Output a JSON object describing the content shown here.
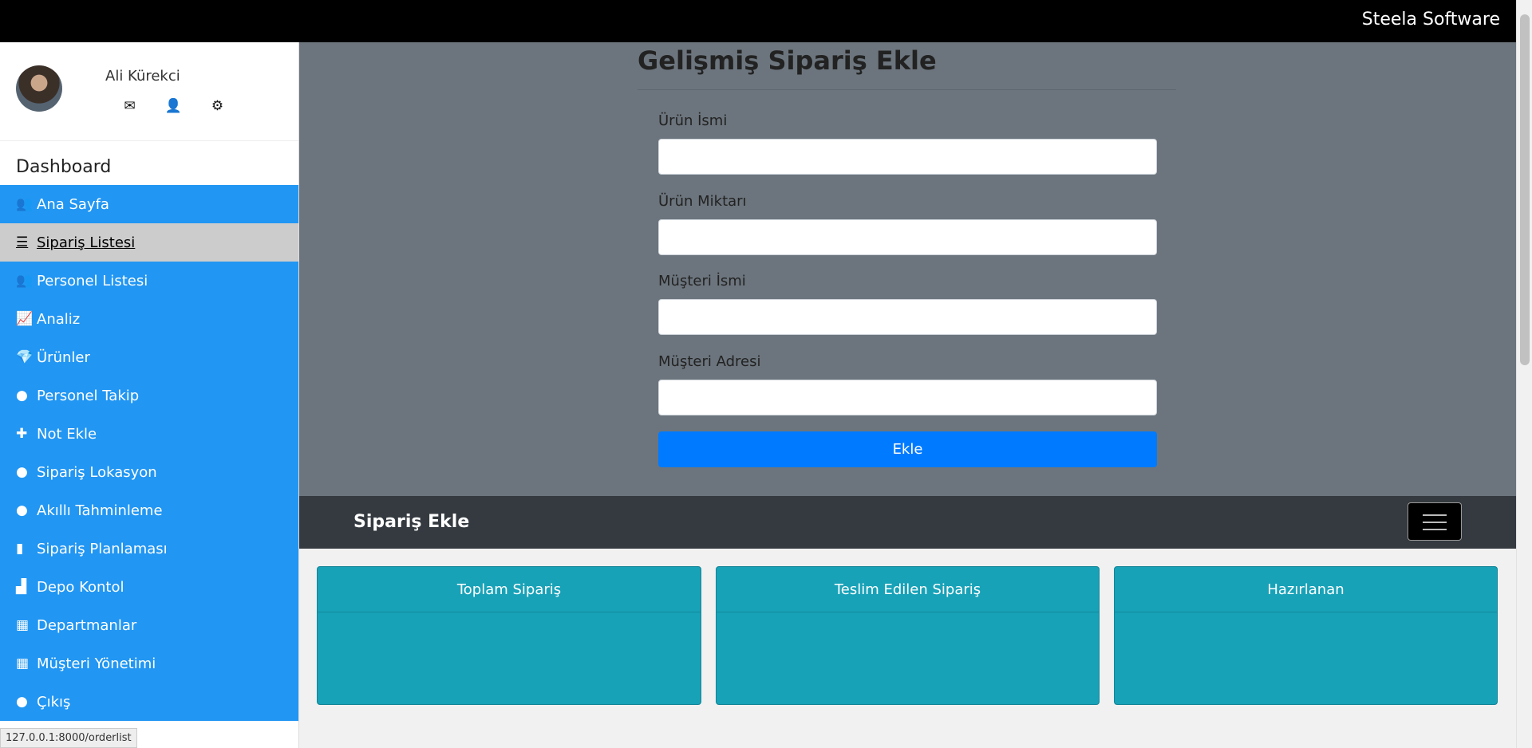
{
  "app": {
    "brand": "Steela Software"
  },
  "user": {
    "name": "Ali Kürekci",
    "icons": [
      "envelope-icon",
      "user-icon",
      "gear-icon"
    ]
  },
  "sidebar": {
    "title": "Dashboard",
    "items": [
      {
        "label": "Ana Sayfa",
        "icon": "users-icon",
        "glyph": "👥"
      },
      {
        "label": " Sipariş Listesi",
        "icon": "list-icon",
        "glyph": "☰",
        "active": true
      },
      {
        "label": "Personel Listesi",
        "icon": "users-icon",
        "glyph": "👥"
      },
      {
        "label": "Analiz",
        "icon": "line-chart-icon",
        "glyph": "📈"
      },
      {
        "label": "Ürünler",
        "icon": "diamond-icon",
        "glyph": "💎"
      },
      {
        "label": "Personel Takip",
        "icon": "globe-icon",
        "glyph": "●"
      },
      {
        "label": "Not Ekle",
        "icon": "plus-icon",
        "glyph": "✚"
      },
      {
        "label": "Sipariş Lokasyon",
        "icon": "globe-icon",
        "glyph": "●"
      },
      {
        "label": "Akıllı Tahminleme",
        "icon": "globe-icon",
        "glyph": "●"
      },
      {
        "label": "Sipariş Planlaması",
        "icon": "book-icon",
        "glyph": "▮"
      },
      {
        "label": "Depo Kontol",
        "icon": "industry-icon",
        "glyph": "▟"
      },
      {
        "label": "Departmanlar",
        "icon": "building-icon",
        "glyph": "▦"
      },
      {
        "label": "Müşteri Yönetimi",
        "icon": "building-icon",
        "glyph": "▦"
      },
      {
        "label": "Çıkış",
        "icon": "globe-icon",
        "glyph": "●"
      }
    ]
  },
  "form": {
    "title": "Gelişmiş Sipariş Ekle",
    "fields": [
      {
        "label": "Ürün İsmi",
        "value": ""
      },
      {
        "label": "Ürün Miktarı",
        "value": ""
      },
      {
        "label": "Müşteri İsmi",
        "value": ""
      },
      {
        "label": "Müşteri Adresi",
        "value": ""
      }
    ],
    "submit_label": "Ekle"
  },
  "navbar": {
    "brand": "Sipariş Ekle",
    "toggler_icon": "hamburger-icon"
  },
  "cards": [
    {
      "title": "Toplam Sipariş"
    },
    {
      "title": "Teslim Edilen Sipariş"
    },
    {
      "title": "Hazırlanan"
    }
  ],
  "status_bar": {
    "url": "127.0.0.1:8000/orderlist"
  },
  "colors": {
    "sidebar_item": "#2196f3",
    "sidebar_active": "#cccccc",
    "form_panel": "#6c757d",
    "button_primary": "#007bff",
    "navbar": "#343a40",
    "card": "#17a2b8"
  }
}
